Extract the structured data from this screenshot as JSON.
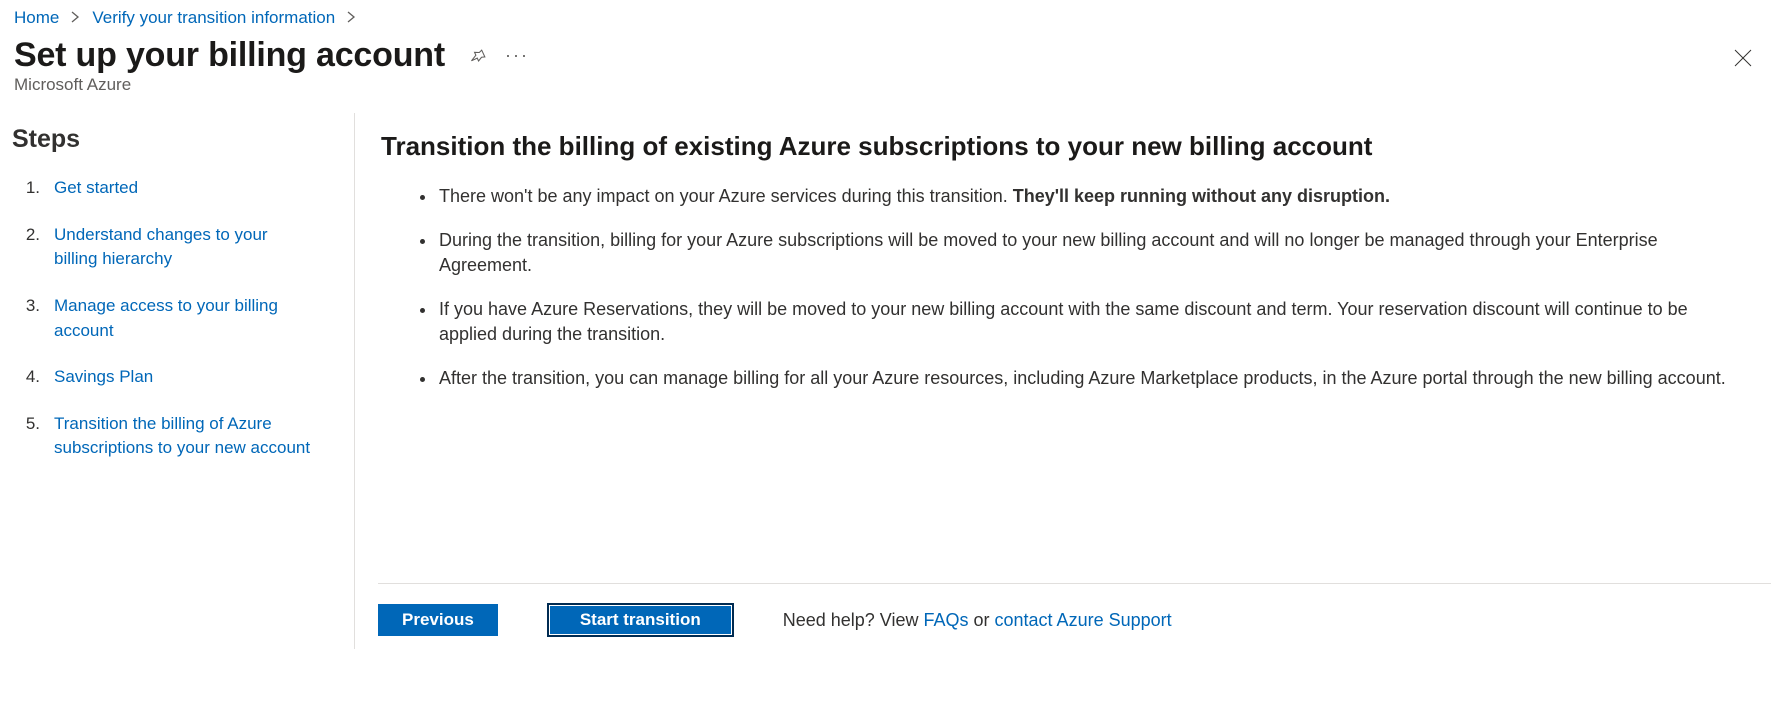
{
  "breadcrumb": {
    "home": "Home",
    "verify": "Verify your transition information"
  },
  "header": {
    "title": "Set up your billing account",
    "subtitle": "Microsoft Azure"
  },
  "sidebar": {
    "title": "Steps",
    "steps": [
      {
        "num": "1.",
        "label": "Get started"
      },
      {
        "num": "2.",
        "label": "Understand changes to your billing hierarchy"
      },
      {
        "num": "3.",
        "label": "Manage access to your billing account"
      },
      {
        "num": "4.",
        "label": "Savings Plan"
      },
      {
        "num": "5.",
        "label": "Transition the billing of Azure subscriptions to your new account"
      }
    ]
  },
  "main": {
    "heading": "Transition the billing of existing Azure subscriptions to your new billing account",
    "bullets": {
      "b1a": "There won't be any impact on your Azure services during this transition. ",
      "b1b": "They'll keep running without any disruption.",
      "b2": "During the transition, billing for your Azure subscriptions will be moved to your new billing account and will no longer be managed through your Enterprise Agreement.",
      "b3": "If you have Azure Reservations, they will be moved to your new billing account with the same discount and term. Your reservation discount will continue to be applied during the transition.",
      "b4": "After the transition, you can manage billing for all your Azure resources, including Azure Marketplace products, in the Azure portal through the new billing account."
    }
  },
  "footer": {
    "prev": "Previous",
    "start": "Start transition",
    "help_prefix": "Need help? View ",
    "faqs": "FAQs",
    "or": " or ",
    "support": "contact Azure Support"
  }
}
